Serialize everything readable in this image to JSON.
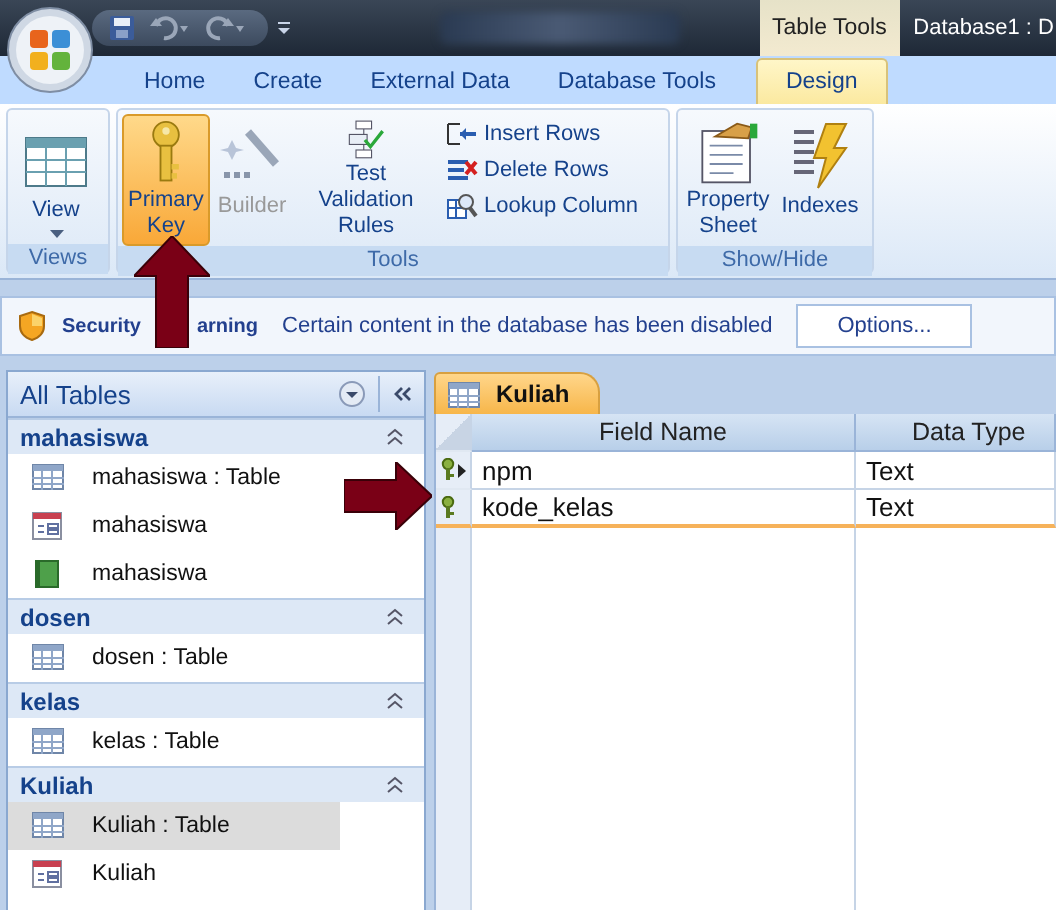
{
  "title_bar": {
    "contextual_tab": "Table Tools",
    "title": "Database1 : D"
  },
  "ribbon_tabs": [
    {
      "label": "Home",
      "selected": false
    },
    {
      "label": "Create",
      "selected": false
    },
    {
      "label": "External Data",
      "selected": false
    },
    {
      "label": "Database Tools",
      "selected": false
    },
    {
      "label": "Design",
      "selected": true
    }
  ],
  "ribbon": {
    "views": {
      "label": "Views",
      "view_button": "View"
    },
    "tools": {
      "label": "Tools",
      "large_buttons": [
        {
          "label": "Primary Key",
          "selected": true,
          "disabled": false
        },
        {
          "label": "Builder",
          "selected": false,
          "disabled": true
        },
        {
          "label": "Test Validation Rules",
          "selected": false,
          "disabled": false
        }
      ],
      "small_buttons": [
        "Insert Rows",
        "Delete Rows",
        "Lookup Column"
      ]
    },
    "show_hide": {
      "label": "Show/Hide",
      "buttons": [
        "Property Sheet",
        "Indexes"
      ]
    }
  },
  "security_bar": {
    "title_start": "Security",
    "title_end": "arning",
    "message": "Certain content in the database has been disabled",
    "button": "Options..."
  },
  "navigation_pane": {
    "header": "All Tables",
    "groups": [
      {
        "label": "mahasiswa",
        "items": [
          {
            "label": "mahasiswa : Table",
            "kind": "table",
            "selected": false
          },
          {
            "label": "mahasiswa",
            "kind": "form",
            "selected": false
          },
          {
            "label": "mahasiswa",
            "kind": "report",
            "selected": false
          }
        ]
      },
      {
        "label": "dosen",
        "items": [
          {
            "label": "dosen : Table",
            "kind": "table",
            "selected": false
          }
        ]
      },
      {
        "label": "kelas",
        "items": [
          {
            "label": "kelas : Table",
            "kind": "table",
            "selected": false
          }
        ]
      },
      {
        "label": "Kuliah",
        "items": [
          {
            "label": "Kuliah : Table",
            "kind": "table",
            "selected": true
          },
          {
            "label": "Kuliah",
            "kind": "form",
            "selected": false
          }
        ]
      }
    ]
  },
  "document": {
    "tab": "Kuliah",
    "columns": [
      "Field Name",
      "Data Type"
    ],
    "rows": [
      {
        "field_name": "npm",
        "data_type": "Text",
        "primary_key": true,
        "selected": true
      },
      {
        "field_name": "kode_kelas",
        "data_type": "Text",
        "primary_key": true,
        "selected": false
      }
    ]
  }
}
